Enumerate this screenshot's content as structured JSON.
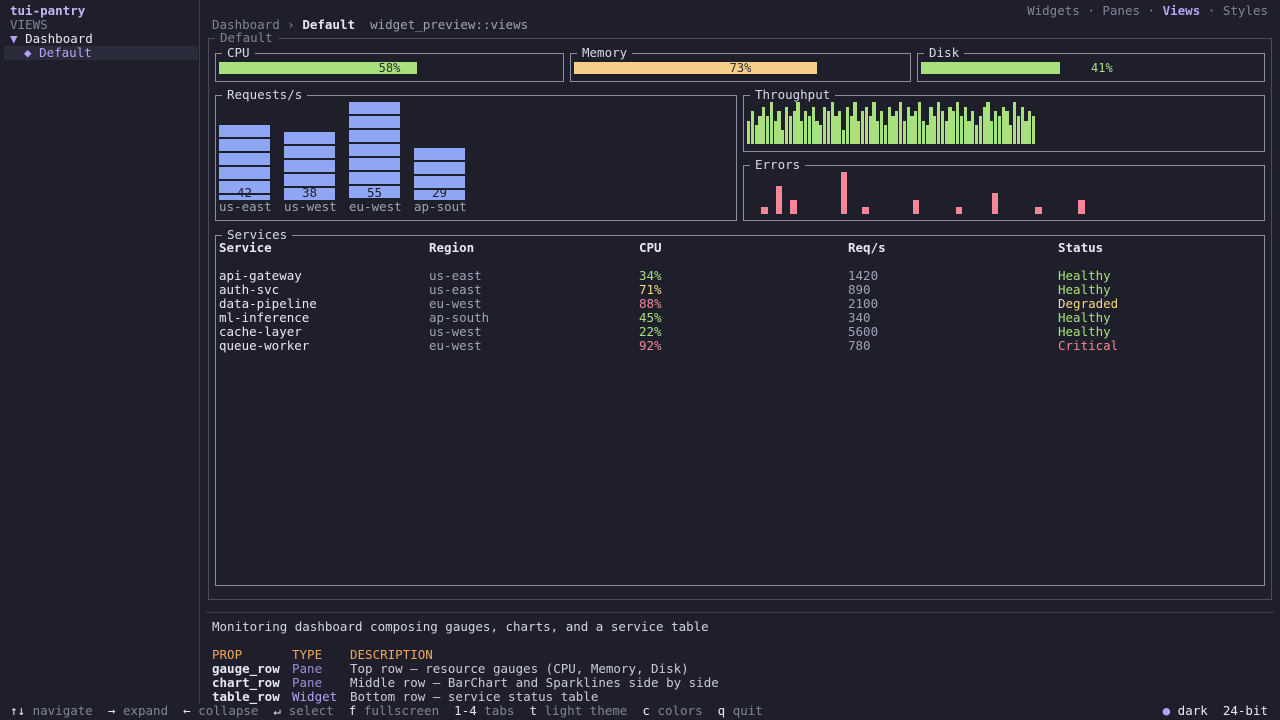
{
  "app": {
    "title": "tui-pantry",
    "section_label": "VIEWS"
  },
  "tree": [
    {
      "label": "Dashboard",
      "glyph": "▼"
    },
    {
      "label": "Default",
      "glyph": "◆"
    }
  ],
  "breadcrumb": {
    "parent": "Dashboard",
    "sep": "›",
    "current": "Default",
    "path": "widget_preview::views"
  },
  "top_tabs": [
    {
      "label": "Widgets"
    },
    {
      "label": "Panes"
    },
    {
      "label": "Views",
      "active": true
    },
    {
      "label": "Styles"
    }
  ],
  "top_tabs_sep": "·",
  "frame_title": "Default",
  "gauges": [
    {
      "title": "CPU",
      "value": 0.58,
      "label": "58%",
      "color": "#a7e07c"
    },
    {
      "title": "Memory",
      "value": 0.73,
      "label": "73%",
      "color": "#f5cf8a"
    },
    {
      "title": "Disk",
      "value": 0.41,
      "label": "41%",
      "color": "#a7e07c"
    }
  ],
  "requests": {
    "title": "Requests/s",
    "bars": [
      {
        "label": "us-east",
        "value": 42,
        "value_label": "42"
      },
      {
        "label": "us-west",
        "value": 38,
        "value_label": "38"
      },
      {
        "label": "eu-west",
        "value": 55,
        "value_label": "55"
      },
      {
        "label": "ap-sout",
        "value": 29,
        "value_label": "29"
      }
    ]
  },
  "throughput": {
    "title": "Throughput",
    "color": "#a7e07c",
    "values": [
      5,
      7,
      4,
      6,
      8,
      6,
      9,
      5,
      7,
      3,
      8,
      6,
      7,
      9,
      5,
      7,
      6,
      8,
      5,
      4,
      8,
      7,
      9,
      6,
      7,
      3,
      8,
      6,
      9,
      5,
      7,
      8,
      6,
      9,
      5,
      7,
      4,
      8,
      6,
      7,
      9,
      5,
      8,
      6,
      7,
      9,
      5,
      4,
      8,
      6,
      9,
      7,
      5,
      8,
      7,
      9,
      6,
      8,
      5,
      7,
      4,
      6,
      8,
      9,
      5,
      7,
      6,
      8,
      7,
      4,
      9,
      6,
      8,
      5,
      7,
      6
    ]
  },
  "errors": {
    "title": "Errors",
    "color": "#f38797",
    "values": [
      0,
      0,
      1,
      0,
      4,
      0,
      2,
      0,
      0,
      0,
      0,
      0,
      0,
      6,
      0,
      0,
      1,
      0,
      0,
      0,
      0,
      0,
      0,
      2,
      0,
      0,
      0,
      0,
      0,
      1,
      0,
      0,
      0,
      0,
      3,
      0,
      0,
      0,
      0,
      0,
      1,
      0,
      0,
      0,
      0,
      0,
      2,
      0,
      0,
      0,
      0,
      0,
      0,
      0,
      0,
      0,
      0,
      0,
      0,
      0,
      0,
      0,
      0,
      0,
      0,
      0,
      0,
      0,
      0,
      0,
      0,
      0,
      0,
      0,
      0,
      0
    ]
  },
  "services": {
    "title": "Services",
    "columns": [
      "Service",
      "Region",
      "CPU",
      "Req/s",
      "Status"
    ],
    "rows": [
      {
        "service": "api-gateway",
        "region": "us-east",
        "cpu": "34%",
        "cpu_level": "green",
        "req": "1420",
        "status": "Healthy",
        "status_level": "green"
      },
      {
        "service": "auth-svc",
        "region": "us-east",
        "cpu": "71%",
        "cpu_level": "yellow",
        "req": "890",
        "status": "Healthy",
        "status_level": "green"
      },
      {
        "service": "data-pipeline",
        "region": "eu-west",
        "cpu": "88%",
        "cpu_level": "red",
        "req": "2100",
        "status": "Degraded",
        "status_level": "yellow"
      },
      {
        "service": "ml-inference",
        "region": "ap-south",
        "cpu": "45%",
        "cpu_level": "green",
        "req": "340",
        "status": "Healthy",
        "status_level": "green"
      },
      {
        "service": "cache-layer",
        "region": "us-west",
        "cpu": "22%",
        "cpu_level": "green",
        "req": "5600",
        "status": "Healthy",
        "status_level": "green"
      },
      {
        "service": "queue-worker",
        "region": "eu-west",
        "cpu": "92%",
        "cpu_level": "red",
        "req": "780",
        "status": "Critical",
        "status_level": "red"
      }
    ]
  },
  "description": "Monitoring dashboard composing gauges, charts, and a service table",
  "props": {
    "headers": [
      "PROP",
      "TYPE",
      "DESCRIPTION"
    ],
    "rows": [
      {
        "prop": "gauge_row",
        "type": "Pane",
        "desc": "Top row — resource gauges (CPU, Memory, Disk)"
      },
      {
        "prop": "chart_row",
        "type": "Pane",
        "desc": "Middle row — BarChart and Sparklines side by side"
      },
      {
        "prop": "table_row",
        "type": "Widget",
        "desc": "Bottom row — service status table"
      }
    ]
  },
  "statusbar": {
    "hints": [
      {
        "key": "↑↓",
        "label": "navigate"
      },
      {
        "key": "→",
        "label": "expand"
      },
      {
        "key": "←",
        "label": "collapse"
      },
      {
        "key": "↵",
        "label": "select"
      },
      {
        "key": "f",
        "label": "fullscreen"
      },
      {
        "key": "1-4",
        "label": "tabs"
      },
      {
        "key": "t",
        "label": "light theme"
      },
      {
        "key": "c",
        "label": "colors"
      },
      {
        "key": "q",
        "label": "quit"
      }
    ],
    "theme_dot": "●",
    "theme": "dark",
    "color_depth": "24-bit"
  },
  "colors": {
    "background": "#1e1f2b",
    "accent": "#b5a2f5",
    "bar": "#8fa6f5",
    "border": "#8a8fa6"
  }
}
